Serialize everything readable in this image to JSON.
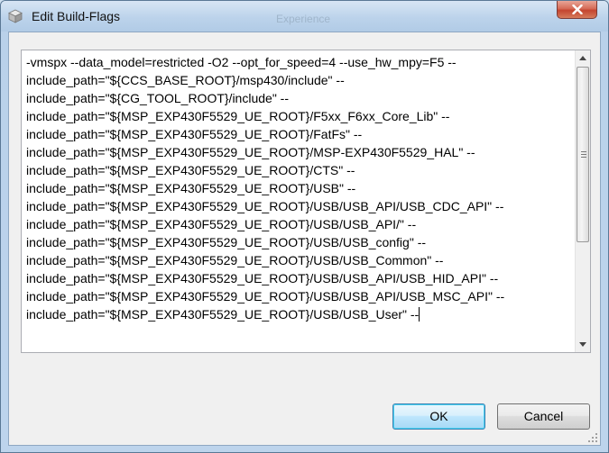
{
  "window": {
    "title": "Edit Build-Flags",
    "ghost_title": "Experience",
    "close_icon": "close-icon",
    "app_icon": "cube-icon"
  },
  "editor": {
    "lines": [
      "-vmspx --data_model=restricted -O2 --opt_for_speed=4 --use_hw_mpy=F5 --",
      "include_path=\"${CCS_BASE_ROOT}/msp430/include\" --",
      "include_path=\"${CG_TOOL_ROOT}/include\" --",
      "include_path=\"${MSP_EXP430F5529_UE_ROOT}/F5xx_F6xx_Core_Lib\" --",
      "include_path=\"${MSP_EXP430F5529_UE_ROOT}/FatFs\" --",
      "include_path=\"${MSP_EXP430F5529_UE_ROOT}/MSP-EXP430F5529_HAL\" --",
      "include_path=\"${MSP_EXP430F5529_UE_ROOT}/CTS\" --",
      "include_path=\"${MSP_EXP430F5529_UE_ROOT}/USB\" --",
      "include_path=\"${MSP_EXP430F5529_UE_ROOT}/USB/USB_API/USB_CDC_API\" --",
      "include_path=\"${MSP_EXP430F5529_UE_ROOT}/USB/USB_API/\" --",
      "include_path=\"${MSP_EXP430F5529_UE_ROOT}/USB/USB_config\" --",
      "include_path=\"${MSP_EXP430F5529_UE_ROOT}/USB/USB_Common\" --",
      "include_path=\"${MSP_EXP430F5529_UE_ROOT}/USB/USB_API/USB_HID_API\" --",
      "include_path=\"${MSP_EXP430F5529_UE_ROOT}/USB/USB_API/USB_MSC_API\" --",
      "include_path=\"${MSP_EXP430F5529_UE_ROOT}/USB/USB_User\" --"
    ]
  },
  "buttons": {
    "ok": "OK",
    "cancel": "Cancel"
  },
  "colors": {
    "frame": "#b9d1ea",
    "close_button": "#c4452f",
    "default_button_border": "#3c7fb1"
  }
}
